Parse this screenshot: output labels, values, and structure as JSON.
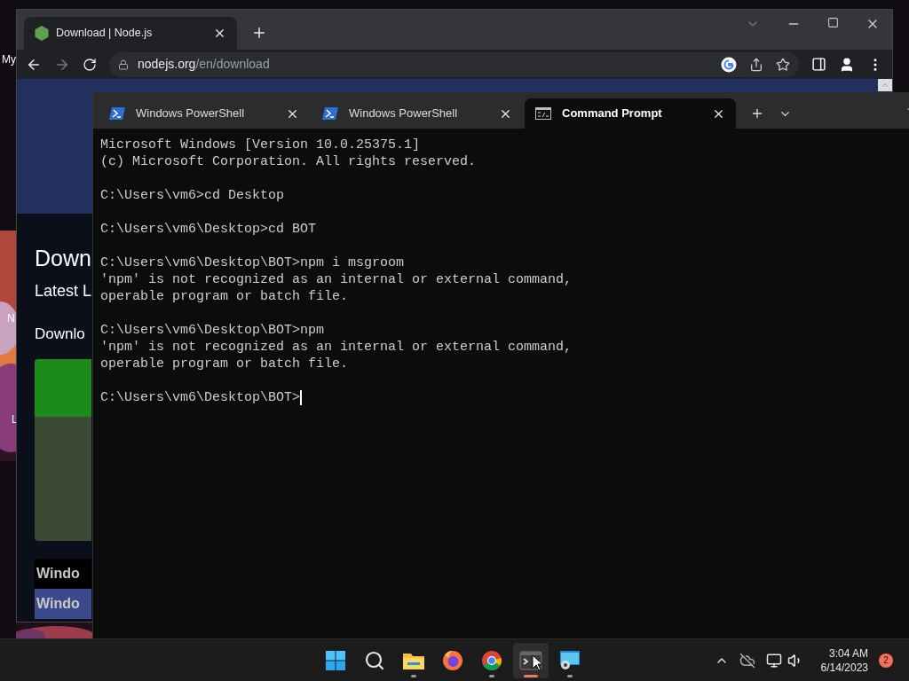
{
  "desktop": {
    "icon_labels": [
      "My",
      "N",
      "L"
    ]
  },
  "browser": {
    "tabs": [
      {
        "title": "Download | Node.js",
        "selected": true
      }
    ],
    "url_host": "nodejs.org",
    "url_path": "/en/download",
    "page": {
      "heading": "Down",
      "subheading": "Latest L",
      "download_label": "Downlo",
      "table_rows": [
        {
          "label": "Windo",
          "selected": false
        },
        {
          "label": "Windo",
          "selected": true
        }
      ]
    }
  },
  "terminal": {
    "tabs": [
      {
        "kind": "powershell",
        "title": "Windows PowerShell",
        "selected": false
      },
      {
        "kind": "powershell",
        "title": "Windows PowerShell",
        "selected": false
      },
      {
        "kind": "cmd",
        "title": "Command Prompt",
        "selected": true
      }
    ],
    "blocks": [
      [
        "Microsoft Windows [Version 10.0.25375.1]",
        "(c) Microsoft Corporation. All rights reserved."
      ],
      [
        "C:\\Users\\vm6>cd Desktop"
      ],
      [
        "C:\\Users\\vm6\\Desktop>cd BOT"
      ],
      [
        "C:\\Users\\vm6\\Desktop\\BOT>npm i msgroom",
        "'npm' is not recognized as an internal or external command,",
        "operable program or batch file."
      ],
      [
        "C:\\Users\\vm6\\Desktop\\BOT>npm",
        "'npm' is not recognized as an internal or external command,",
        "operable program or batch file."
      ]
    ],
    "prompt": "C:\\Users\\vm6\\Desktop\\BOT>"
  },
  "taskbar": {
    "apps": [
      {
        "kind": "start",
        "running": false,
        "active": false
      },
      {
        "kind": "search",
        "running": false,
        "active": false
      },
      {
        "kind": "explorer",
        "running": true,
        "active": false
      },
      {
        "kind": "firefox",
        "running": false,
        "active": false
      },
      {
        "kind": "chrome",
        "running": true,
        "active": false
      },
      {
        "kind": "terminal",
        "running": true,
        "active": true
      },
      {
        "kind": "remote",
        "running": true,
        "active": false
      }
    ],
    "clock": {
      "time": "3:04 AM",
      "date": "6/14/2023"
    },
    "notification_count": "2"
  }
}
